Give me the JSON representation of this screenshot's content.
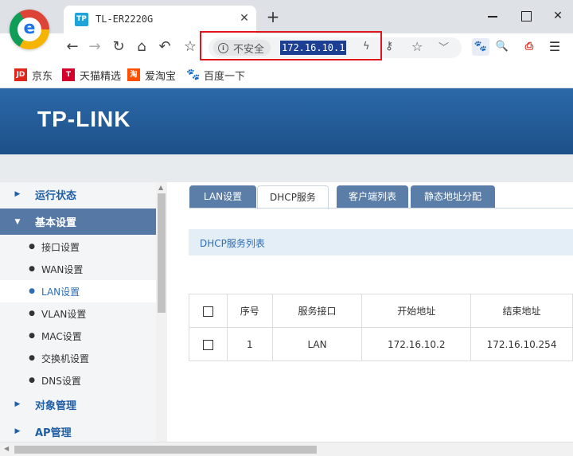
{
  "browser": {
    "tab_title": "TL-ER2220G",
    "tab_favicon": "TP",
    "security_label": "不安全",
    "url": "172.16.10.1",
    "icons": {
      "back": "arrow-left-icon",
      "forward": "arrow-right-icon",
      "reload": "reload-icon",
      "home": "home-icon",
      "undo": "undo-icon",
      "star": "star-icon",
      "bolt": "lightning-icon",
      "key": "key-icon",
      "menu": "menu-icon"
    }
  },
  "bookmarks": [
    {
      "label": "京东",
      "icon": "JD"
    },
    {
      "label": "天猫精选",
      "icon": "T"
    },
    {
      "label": "爱淘宝",
      "icon": "淘"
    },
    {
      "label": "百度一下",
      "icon": "🐾"
    }
  ],
  "router": {
    "brand": "TP-LINK",
    "sidebar": {
      "groups": {
        "status": "运行状态",
        "basic": "基本设置",
        "object": "对象管理",
        "ap": "AP管理"
      },
      "basic_items": [
        "接口设置",
        "WAN设置",
        "LAN设置",
        "VLAN设置",
        "MAC设置",
        "交换机设置",
        "DNS设置"
      ],
      "active_item": "LAN设置"
    },
    "tabs": [
      "LAN设置",
      "DHCP服务",
      "客户端列表",
      "静态地址分配"
    ],
    "active_tab": "DHCP服务",
    "section_title": "DHCP服务列表",
    "table": {
      "headers": [
        "序号",
        "服务接口",
        "开始地址",
        "结束地址"
      ],
      "rows": [
        {
          "index": "1",
          "interface": "LAN",
          "start": "172.16.10.2",
          "end": "172.16.10.254"
        }
      ]
    }
  },
  "colors": {
    "header_blue": "#1d5088",
    "tab_blue": "#5a7ea7",
    "accent_text": "#2f6db5",
    "highlight_red": "#e0161d"
  }
}
